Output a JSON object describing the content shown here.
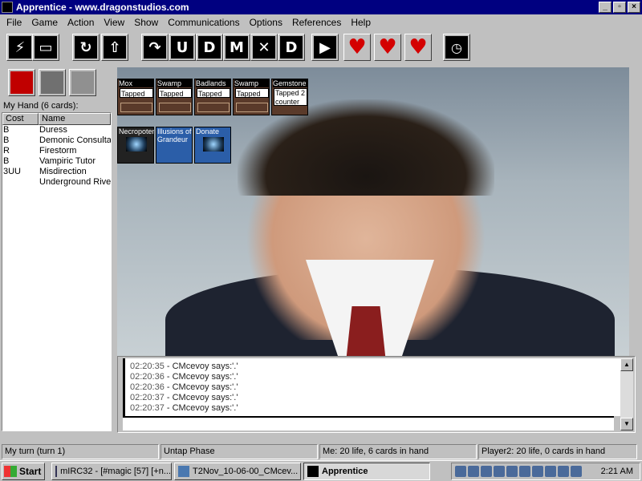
{
  "window": {
    "title": "Apprentice - www.dragonstudios.com",
    "buttons": [
      "_",
      "▫",
      "×"
    ]
  },
  "menu": [
    {
      "label": "File"
    },
    {
      "label": "Game"
    },
    {
      "label": "Action"
    },
    {
      "label": "View"
    },
    {
      "label": "Show"
    },
    {
      "label": "Communications"
    },
    {
      "label": "Options"
    },
    {
      "label": "References"
    },
    {
      "label": "Help"
    }
  ],
  "toolbar": [
    {
      "icon": "wand-icon",
      "glyph": "⚡"
    },
    {
      "icon": "book-open-icon",
      "glyph": "▭"
    },
    {
      "icon": "shuffle-icon",
      "glyph": "↻"
    },
    {
      "icon": "draw-card-icon",
      "glyph": "⇧"
    },
    {
      "icon": "play-arrow-icon",
      "glyph": "↷"
    },
    {
      "icon": "untap-phase-icon",
      "glyph": "U"
    },
    {
      "icon": "draw-phase-icon",
      "glyph": "D"
    },
    {
      "icon": "main-phase-icon",
      "glyph": "M"
    },
    {
      "icon": "combat-phase-icon",
      "glyph": "✕"
    },
    {
      "icon": "discard-phase-icon",
      "glyph": "D"
    },
    {
      "icon": "end-turn-icon",
      "glyph": "▶"
    },
    {
      "icon": "heart-icon",
      "glyph": "♥"
    },
    {
      "icon": "heart-minus-icon",
      "glyph": "♥"
    },
    {
      "icon": "heart-plus-icon",
      "glyph": "♥"
    },
    {
      "icon": "stopwatch-icon",
      "glyph": "◷"
    }
  ],
  "toolbar2": [
    {
      "icon": "graveyard-book-icon"
    },
    {
      "icon": "tombstone-icon"
    },
    {
      "icon": "trash-can-icon"
    }
  ],
  "hand": {
    "label": "My Hand (6 cards):",
    "columns": [
      "Cost",
      "Name"
    ],
    "rows": [
      {
        "cost": "B",
        "name": "Duress"
      },
      {
        "cost": "B",
        "name": "Demonic Consultat"
      },
      {
        "cost": "R",
        "name": "Firestorm"
      },
      {
        "cost": "B",
        "name": "Vampiric Tutor"
      },
      {
        "cost": "3UU",
        "name": "Misdirection"
      },
      {
        "cost": "",
        "name": "Underground River"
      }
    ]
  },
  "battlefield": {
    "row1": [
      {
        "name": "Mox",
        "status": "Tapped"
      },
      {
        "name": "Swamp",
        "status": "Tapped"
      },
      {
        "name": "Badlands",
        "status": "Tapped"
      },
      {
        "name": "Swamp",
        "status": "Tapped"
      },
      {
        "name": "Gemstone",
        "status": "Tapped 2 counter"
      }
    ],
    "row2": [
      {
        "name": "Necropotence",
        "status": ""
      },
      {
        "name": "Illusions of Grandeur",
        "status": ""
      },
      {
        "name": "Donate",
        "status": ""
      }
    ]
  },
  "chat": {
    "lines": [
      {
        "time": "02:20:35",
        "text": " - CMcevoy says:'.'"
      },
      {
        "time": "02:20:36",
        "text": " - CMcevoy says:'.'"
      },
      {
        "time": "02:20:36",
        "text": " - CMcevoy says:'.'"
      },
      {
        "time": "02:20:37",
        "text": " - CMcevoy says:'.'"
      },
      {
        "time": "02:20:37",
        "text": " - CMcevoy says:'.'"
      }
    ],
    "input_value": ""
  },
  "status": {
    "turn": "My turn (turn 1)",
    "phase": "Untap Phase",
    "me": "Me: 20 life, 6 cards in hand",
    "opponent": "Player2: 20 life, 0 cards in hand"
  },
  "taskbar": {
    "start": "Start",
    "tasks": [
      {
        "label": "mIRC32 - [#magic [57] [+n..."
      },
      {
        "label": "T2Nov_10-06-00_CMcev..."
      },
      {
        "label": "Apprentice"
      }
    ],
    "clock": "2:21 AM"
  },
  "colors": {
    "titlebar": "#000080",
    "chrome": "#c0c0c0",
    "heart": "#d40000"
  }
}
